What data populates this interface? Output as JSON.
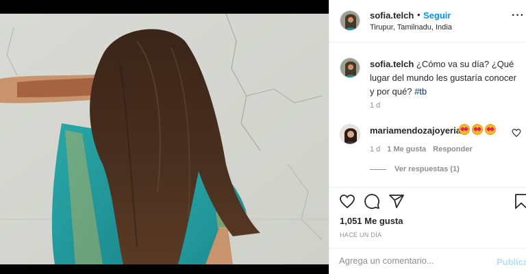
{
  "post": {
    "username": "sofia.telch",
    "follow_separator": "•",
    "follow_label": "Seguir",
    "location": "Tirupur, Tamilnadu, India",
    "more_label": "···"
  },
  "caption": {
    "username": "sofia.telch",
    "text": "¿Cómo va su día? ¿Qué lugar del mundo les gustaría conocer y por qué?",
    "hashtag": "#tb",
    "time": "1 d"
  },
  "comment": {
    "username": "mariamendozajoyeria",
    "emoji": [
      "star-struck-emoji",
      "star-struck-emoji",
      "star-struck-emoji"
    ],
    "time": "1 d",
    "likes": "1 Me gusta",
    "reply_label": "Responder",
    "view_replies": "Ver respuestas (1)"
  },
  "actions": {
    "icons": [
      "heart-icon",
      "comment-icon",
      "share-icon",
      "bookmark-icon"
    ],
    "likes_count": "1,051 Me gusta",
    "timestamp": "HACE UN DÍA"
  },
  "composer": {
    "placeholder": "Agrega un comentario...",
    "post_label": "Publicar"
  },
  "colors": {
    "link": "#0095f6",
    "hashtag": "#00376b",
    "muted": "#8e8e8e",
    "post_disabled": "#b2dffc"
  }
}
